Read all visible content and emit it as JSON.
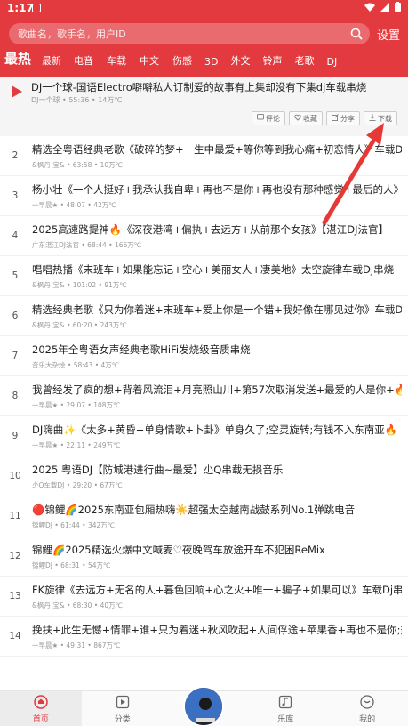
{
  "status": {
    "time": "1:17"
  },
  "search": {
    "placeholder": "歌曲名，歌手名，用户ID",
    "settings_label": "设置"
  },
  "tabs": [
    {
      "label": "最热",
      "active": true
    },
    {
      "label": "最新"
    },
    {
      "label": "电音"
    },
    {
      "label": "车载"
    },
    {
      "label": "中文"
    },
    {
      "label": "伤感"
    },
    {
      "label": "3D"
    },
    {
      "label": "外文"
    },
    {
      "label": "铃声"
    },
    {
      "label": "老歌"
    },
    {
      "label": "DJ"
    }
  ],
  "featured": {
    "title": "DJ一个球-国语Electro噼噼私人订制爱的故事有上集却没有下集dj车载串烧",
    "meta": "DJ一个球 • 55:36 • 14万℃",
    "actions": {
      "comment": "评论",
      "favorite": "收藏",
      "share": "分享",
      "download": "下载"
    }
  },
  "songs": [
    {
      "num": "2",
      "title": "精选全粤语经典老歌《破碎的梦+一生中最爱+等你等到我心痛+初恋情人》车载Dj串烧",
      "meta": "&枫丹 宝& • 63:58 • 10万℃"
    },
    {
      "num": "3",
      "title": "杨小壮《一个人挺好+我承认我自卑+再也不是你+再也没有那种感觉+最后的人》12首",
      "meta": "一早晨★ • 48:07 • 42万℃"
    },
    {
      "num": "4",
      "title": "2025高速路提神🔥《深夜港湾+偏执+去远方+从前那个女孩》【湛江DJ法官】",
      "meta": "广东湛江DJ法官 • 68:44 • 166万℃"
    },
    {
      "num": "5",
      "title": "唱唱热播《末班车+如果能忘记+空心+美丽女人+凄美地》太空旋律车载Dj串烧",
      "meta": "&枫丹 宝& • 101:02 • 91万℃"
    },
    {
      "num": "6",
      "title": "精选经典老歌《只为你着迷+末班车+爱上你是一个错+我好像在哪见过你》车载Dj串烧",
      "meta": "&枫丹 宝& • 60:20 • 243万℃"
    },
    {
      "num": "7",
      "title": "2025年全粤语女声经典老歌HiFi发烧级音质串烧",
      "meta": "音乐大杂烩 • 58:43 • 4万℃"
    },
    {
      "num": "8",
      "title": "我曾经发了疯的想+背着风流泪+月亮照山川+第57次取消发送+最爱的人是你+🔥",
      "meta": "一早晨★ • 29:07 • 108万℃"
    },
    {
      "num": "9",
      "title": "DJ嗨曲✨《太多+黄昏+单身情歌+卜卦》单身久了;空灵旋转;有钱不入东南亚🔥",
      "meta": "一早晨★ • 22:11 • 249万℃"
    },
    {
      "num": "10",
      "title": "2025 粤语DJ【防城港进行曲~最爱】尐Q串载无损音乐",
      "meta": "尐Q车载DJ • 29:20 • 67万℃"
    },
    {
      "num": "11",
      "title": "🔴锦鲤🌈2025东南亚包厢热嗨☀️超强太空越南战鼓系列No.1弹跳电音",
      "meta": "锦鲤DJ • 61:44 • 342万℃"
    },
    {
      "num": "12",
      "title": "锦鲤🌈2025精选火爆中文喊麦♡夜晚驾车放途开车不犯困ReMix",
      "meta": "锦鲤DJ • 68:31 • 54万℃"
    },
    {
      "num": "13",
      "title": "FK旋律《去远方+无名的人+暮色回响+心之火+唯一+骗子+如果可以》车载Dj串烧",
      "meta": "&枫丹 宝& • 68:30 • 40万℃"
    },
    {
      "num": "14",
      "title": "挽扶+此生无憾+情罪+谁+只为着迷+秋风吹起+人间俘途+苹果香+再也不是你;热歌",
      "meta": "一早晨★ • 49:31 • 867万℃"
    }
  ],
  "bottom_nav": [
    {
      "label": "首页",
      "icon": "home-icon",
      "active": true
    },
    {
      "label": "分类",
      "icon": "category-icon"
    },
    {
      "label": "",
      "icon": "now-playing-disc"
    },
    {
      "label": "乐库",
      "icon": "music-library-icon"
    },
    {
      "label": "我的",
      "icon": "profile-icon"
    }
  ],
  "colors": {
    "brand": "#e23a3f",
    "highlight": "#e8a000",
    "background": "#ffffff"
  }
}
